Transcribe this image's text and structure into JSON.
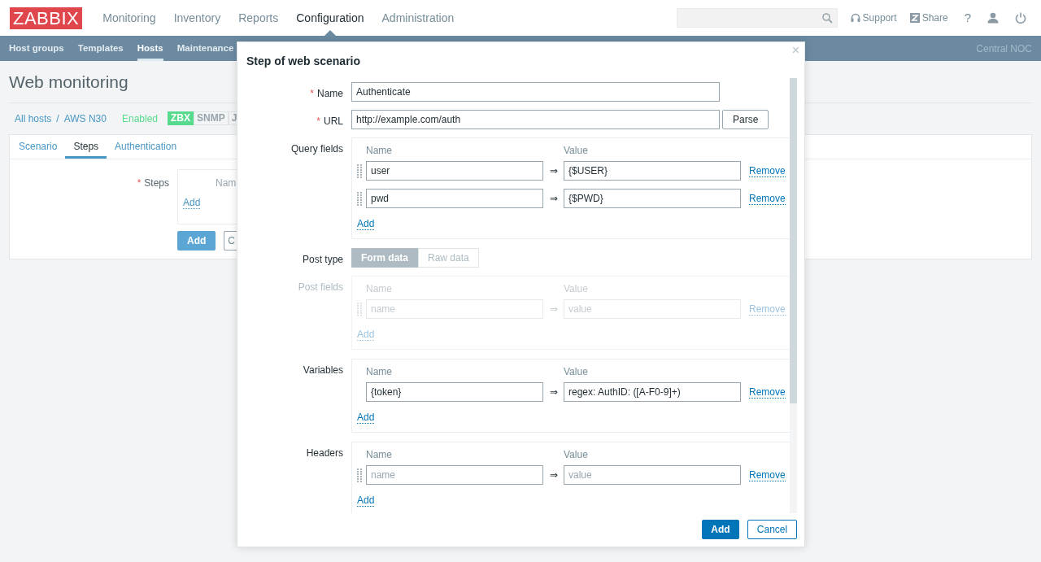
{
  "logo": "ZABBIX",
  "main_menu": [
    {
      "label": "Monitoring",
      "selected": false
    },
    {
      "label": "Inventory",
      "selected": false
    },
    {
      "label": "Reports",
      "selected": false
    },
    {
      "label": "Configuration",
      "selected": true
    },
    {
      "label": "Administration",
      "selected": false
    }
  ],
  "header_links": [
    {
      "label": "Support",
      "kind": "support"
    },
    {
      "label": "Share",
      "kind": "share"
    }
  ],
  "help": "?",
  "sub_menu": [
    {
      "label": "Host groups",
      "selected": false
    },
    {
      "label": "Templates",
      "selected": false
    },
    {
      "label": "Hosts",
      "selected": true
    },
    {
      "label": "Maintenance",
      "selected": false
    }
  ],
  "server_name": "Central NOC",
  "page_title": "Web monitoring",
  "breadcrumbs": [
    {
      "label": "All hosts",
      "separator": "/"
    },
    {
      "label": "AWS N30"
    }
  ],
  "host_status": "Enabled",
  "availability": [
    {
      "label": "ZBX",
      "kind": "ok"
    },
    {
      "label": "SNMP",
      "kind": "unknown"
    },
    {
      "label": "J",
      "kind": "unknown"
    }
  ],
  "form_tabs": [
    {
      "label": "Scenario",
      "selected": false
    },
    {
      "label": "Steps",
      "selected": true
    },
    {
      "label": "Authentication",
      "selected": false
    }
  ],
  "steps": {
    "required_mark": "*",
    "label": "Steps",
    "column": "Nam",
    "add": "Add"
  },
  "form_buttons": [
    {
      "label": "Add",
      "kind": "primary"
    },
    {
      "label": "C",
      "kind": "secondary"
    }
  ],
  "dialog": {
    "title": "Step of web scenario",
    "close": "×",
    "fields": [
      {
        "kind": "text",
        "label": "Name",
        "required_mark": "*",
        "value": "Authenticate"
      },
      {
        "kind": "text",
        "label": "URL",
        "required_mark": "*",
        "value": "http://example.com/auth",
        "button": "Parse"
      },
      {
        "kind": "pairs",
        "label": "Query fields",
        "disabled": false,
        "columns": [
          "Name",
          "Value"
        ],
        "add": "Add",
        "rows": [
          {
            "draggable": true,
            "name": "user",
            "separator": "⇒",
            "value": "{$USER}",
            "remove": "Remove"
          },
          {
            "draggable": true,
            "name": "pwd",
            "separator": "⇒",
            "value": "{$PWD}",
            "remove": "Remove"
          }
        ]
      },
      {
        "kind": "toggle",
        "label": "Post type",
        "options": [
          {
            "label": "Form data",
            "selected": true
          },
          {
            "label": "Raw data",
            "selected": false
          }
        ]
      },
      {
        "kind": "pairs",
        "label": "Post fields",
        "disabled": true,
        "columns": [
          "Name",
          "Value"
        ],
        "add": "Add",
        "rows": [
          {
            "draggable": true,
            "name_placeholder": "name",
            "separator": "⇒",
            "value_placeholder": "value",
            "remove": "Remove"
          }
        ]
      },
      {
        "kind": "pairs",
        "label": "Variables",
        "disabled": false,
        "columns": [
          "Name",
          "Value"
        ],
        "add": "Add",
        "rows": [
          {
            "draggable": false,
            "name": "{token}",
            "separator": "⇒",
            "value": "regex: AuthID: ([A-F0-9]+)",
            "remove": "Remove"
          }
        ]
      },
      {
        "kind": "pairs",
        "label": "Headers",
        "disabled": false,
        "columns": [
          "Name",
          "Value"
        ],
        "add": "Add",
        "rows": [
          {
            "draggable": true,
            "name_placeholder": "name",
            "separator": "⇒",
            "value_placeholder": "value",
            "remove": "Remove"
          }
        ]
      }
    ],
    "buttons": [
      {
        "label": "Add",
        "kind": "primary"
      },
      {
        "label": "Cancel",
        "kind": "secondary"
      }
    ]
  }
}
